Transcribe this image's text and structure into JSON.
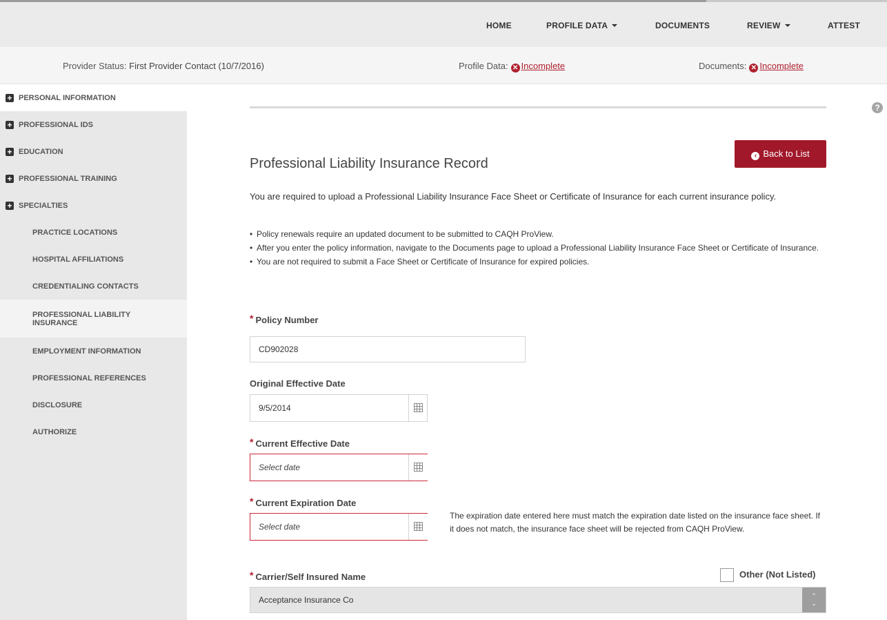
{
  "topnav": {
    "items": [
      {
        "label": "HOME",
        "dropdown": false
      },
      {
        "label": "PROFILE DATA",
        "dropdown": true
      },
      {
        "label": "DOCUMENTS",
        "dropdown": false
      },
      {
        "label": "REVIEW",
        "dropdown": true
      },
      {
        "label": "ATTEST",
        "dropdown": false
      }
    ]
  },
  "status": {
    "provider_label": "Provider Status:",
    "provider_value": "First Provider Contact (10/7/2016)",
    "profile_label": "Profile Data:",
    "profile_value": "Incomplete",
    "documents_label": "Documents:",
    "documents_value": "Incomplete"
  },
  "sidebar": {
    "items": [
      {
        "label": "PERSONAL INFORMATION",
        "icon": "plus-icon"
      },
      {
        "label": "PROFESSIONAL IDS",
        "icon": "plus-icon"
      },
      {
        "label": "EDUCATION",
        "icon": "plus-icon"
      },
      {
        "label": "PROFESSIONAL TRAINING",
        "icon": "plus-icon"
      },
      {
        "label": "SPECIALTIES",
        "icon": "plus-icon"
      },
      {
        "label": "PRACTICE LOCATIONS"
      },
      {
        "label": "HOSPITAL AFFILIATIONS"
      },
      {
        "label": "CREDENTIALING CONTACTS"
      },
      {
        "label": "PROFESSIONAL LIABILITY INSURANCE",
        "selected": true
      },
      {
        "label": "EMPLOYMENT INFORMATION"
      },
      {
        "label": "PROFESSIONAL REFERENCES"
      },
      {
        "label": "DISCLOSURE"
      },
      {
        "label": "AUTHORIZE"
      }
    ]
  },
  "main": {
    "title": "Professional Liability Insurance Record",
    "back_button": "Back to List",
    "intro": "You are required to upload a Professional Liability Insurance Face Sheet or Certificate of Insurance for each current insurance policy.",
    "bullets": [
      "Policy renewals require an updated document to be submitted to CAQH ProView.",
      "After you enter the policy information, navigate to the Documents page to upload a Professional Liability Insurance Face Sheet or Certificate of Insurance.",
      "You are not required to submit a Face Sheet or Certificate of Insurance for expired policies."
    ],
    "required_mark": "*",
    "policy_number_label": "Policy Number",
    "policy_number_value": "CD902028",
    "original_effective_label": "Original Effective Date",
    "original_effective_value": "9/5/2014",
    "current_effective_label": "Current Effective Date",
    "current_effective_placeholder": "Select date",
    "current_expiration_label": "Current Expiration Date",
    "current_expiration_placeholder": "Select date",
    "expiration_note": "The expiration date entered here must match the expiration date listed on the insurance face sheet. If it does not match, the insurance face sheet will be rejected from CAQH ProView.",
    "carrier_label": "Carrier/Self Insured Name",
    "other_label": "Other (Not Listed)",
    "carrier_value": "Acceptance Insurance Co"
  },
  "colors": {
    "accent": "#a1182a",
    "error": "#c9283a",
    "sidebar_bg": "#e8e8e8",
    "topbar_bg": "#ebebeb"
  }
}
